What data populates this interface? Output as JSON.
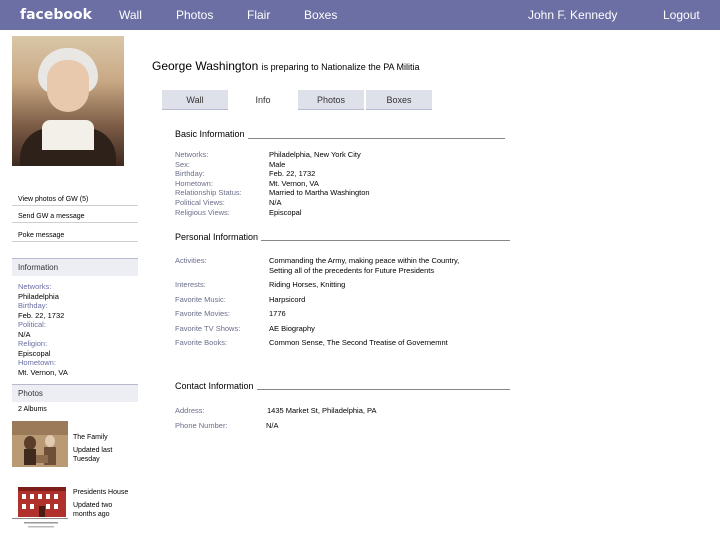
{
  "topbar": {
    "logo": "facebook",
    "nav": [
      "Wall",
      "Photos",
      "Flair",
      "Boxes"
    ],
    "user": "John F. Kennedy",
    "logout": "Logout"
  },
  "left": {
    "view_photos": "View photos of GW (5)",
    "send_message": "Send GW a message",
    "poke": "Poke message",
    "information_header": "Information",
    "info": [
      {
        "label": "Networks:",
        "value": "Philadelphia"
      },
      {
        "label": "Birthday:",
        "value": "Feb. 22, 1732"
      },
      {
        "label": "Political:",
        "value": "N/A"
      },
      {
        "label": "Religion:",
        "value": "Episcopal"
      },
      {
        "label": "Hometown:",
        "value": "Mt. Vernon, VA"
      }
    ],
    "photos_header": "Photos",
    "albums_count": "2 Albums",
    "albums": [
      {
        "title": "The Family",
        "updated": "Updated last Tuesday"
      },
      {
        "title": "Presidents House",
        "updated": "Updated two months ago"
      }
    ]
  },
  "status": {
    "name": "George Washington",
    "text": "is preparing to Nationalize the PA Militia"
  },
  "tabs": [
    "Wall",
    "Info",
    "Photos",
    "Boxes"
  ],
  "basic": {
    "title": "Basic Information",
    "labels": [
      "Networks:",
      "Sex:",
      "Birthday:",
      "Hometown:",
      "Relationship Status:",
      "Political Views:",
      "Religious Views:"
    ],
    "values": [
      "Philadelphia, New York City",
      "Male",
      "Feb. 22, 1732",
      "Mt. Vernon, VA",
      "Married to Martha Washington",
      "N/A",
      "Episcopal"
    ]
  },
  "personal": {
    "title": "Personal Information",
    "activities_label": "Activities:",
    "activities_value_1": "Commanding the Army, making peace within the Country,",
    "activities_value_2": "Setting all of the precedents for Future Presidents",
    "interests_label": "Interests:",
    "interests_value": "Riding Horses, Knitting",
    "music_label": "Favorite Music:",
    "music_value": "Harpsicord",
    "movies_label": "Favorite Movies:",
    "movies_value": "1776",
    "tv_label": "Favorite TV Shows:",
    "tv_value": "AE Biography",
    "books_label": "Favorite Books:",
    "books_value": "Common Sense, The Second Treatise of Governemnt"
  },
  "contact": {
    "title": "Contact Information",
    "address_label": "Address:",
    "address_value": "1435 Market St, Philadelphia, PA",
    "phone_label": "Phone Number:",
    "phone_value": "N/A"
  },
  "colors": {
    "topbar": "#6b6fa3",
    "label": "#6b6f8a",
    "tab_bg": "#dfe1ea"
  }
}
